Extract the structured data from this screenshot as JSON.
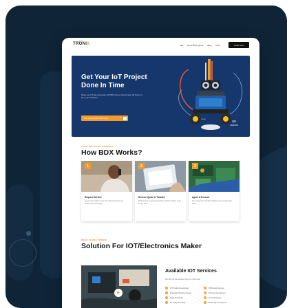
{
  "nav": {
    "logo_main": "TRONI",
    "logo_x": "X",
    "logo_sup": "BDX",
    "links": [
      "BE",
      "Get a BDX Quote",
      "Blog",
      "FAQ"
    ],
    "order_button": "Order Now"
  },
  "hero": {
    "title": "Get Your IoT Project Done In Time",
    "description": "Share your IoT idea and project with BDX and our experts team will bring it to life in your timeframe.",
    "button_label": "Get Your Project Built Now",
    "button_arrow": "→",
    "brand_symbol": "∞",
    "brand_label": "ARDUINO"
  },
  "how_section": {
    "eyebrow": "YOUR IOT IDEAS CONNECT",
    "title": "How BDX Works?",
    "cards": [
      {
        "num": "1",
        "title": "Request Service",
        "desc": "Send us the details of your idea and we'll review your requirements thoroughly."
      },
      {
        "num": "2",
        "title": "Receive Quote & Timeline",
        "desc": "We'll send you a quote along with a realistic timeline to get the job done."
      },
      {
        "num": "3",
        "title": "Agree & Execute",
        "desc": "Once agreed we will start working on your project right away."
      }
    ]
  },
  "solution_section": {
    "eyebrow": "WHAT IS BDX TRONIX",
    "title": "Solution For IOT/Electronics Maker"
  },
  "video": {
    "play_icon": "▶"
  },
  "services": {
    "title": "Available IOT Services",
    "description": "We offer all the services that you might need",
    "items": [
      "IOT Product Development",
      "PCB Design Services",
      "Embedded Hardware Design",
      "Firmware Development",
      "Rapid Prototyping",
      "Circuit Simulation",
      "3D Design & Printing",
      "Mobile App Development"
    ],
    "check_glyph": "✓"
  },
  "colors": {
    "accent": "#f39a2b",
    "hero_bg": "#15376b",
    "frame_bg": "#0f2537"
  }
}
